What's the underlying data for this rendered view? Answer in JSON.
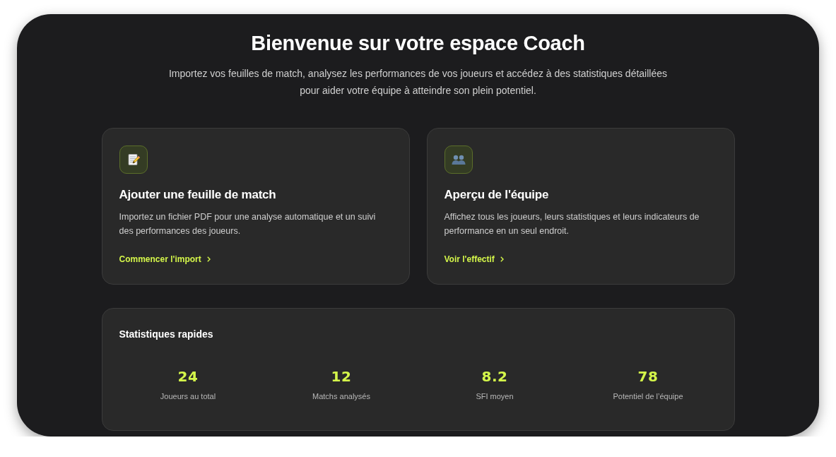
{
  "header": {
    "title": "Bienvenue sur votre espace Coach",
    "subtitle": "Importez vos feuilles de match, analysez les performances de vos joueurs et accédez à des statistiques détaillées pour aider votre équipe à atteindre son plein potentiel."
  },
  "cards": [
    {
      "kind": "memo",
      "title": "Ajouter une feuille de match",
      "description": "Importez un fichier PDF pour une analyse automatique et un suivi des performances des joueurs.",
      "link": "Commencer l'import"
    },
    {
      "kind": "people",
      "title": "Aperçu de l'équipe",
      "description": "Affichez tous les joueurs, leurs statistiques et leurs indicateurs de performance en un seul endroit.",
      "link": "Voir l'effectif"
    }
  ],
  "quick_stats": {
    "title": "Statistiques rapides",
    "items": [
      {
        "value": "24",
        "label": "Joueurs au total"
      },
      {
        "value": "12",
        "label": "Matchs analysés"
      },
      {
        "value": "8.2",
        "label": "SFI moyen"
      },
      {
        "value": "78",
        "label": "Potentiel de l’équipe"
      }
    ]
  }
}
